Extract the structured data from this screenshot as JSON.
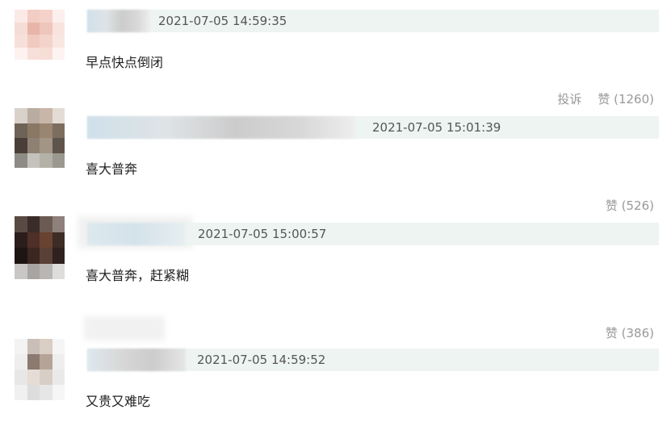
{
  "comments": [
    {
      "time": "2021-07-05 14:59:35",
      "text": "早点快点倒闭",
      "actions": {
        "report": "投诉",
        "like": "赞 (1260)"
      }
    },
    {
      "time": "2021-07-05 15:01:39",
      "text": "喜大普奔",
      "actions": {
        "like": "赞 (526)"
      }
    },
    {
      "time": "2021-07-05 15:00:57",
      "text": "喜大普奔，赶紧糊",
      "actions": {
        "like": "赞 (386)"
      }
    },
    {
      "time": "2021-07-05 14:59:52",
      "text": "又贵又难吃"
    }
  ]
}
